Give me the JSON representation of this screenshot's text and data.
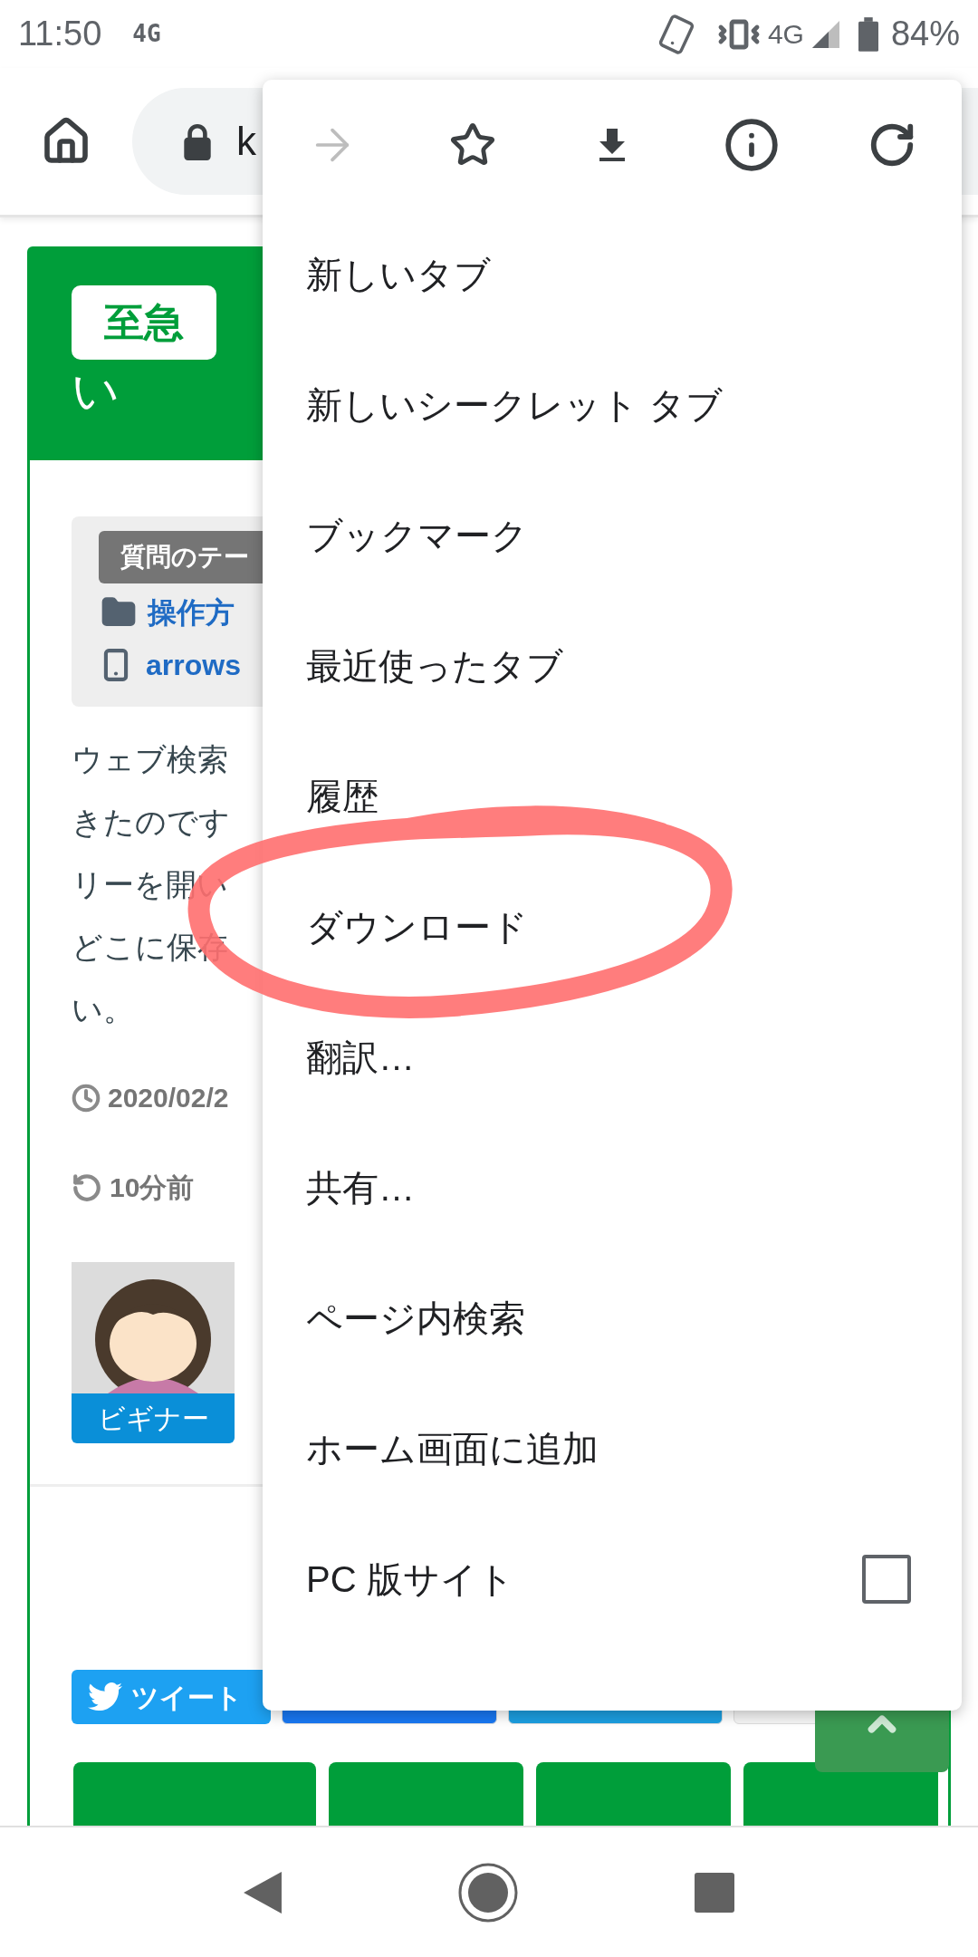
{
  "status_bar": {
    "time": "11:50",
    "network_badge": "4G",
    "network": "4G",
    "battery": "84%"
  },
  "toolbar": {
    "url": "k"
  },
  "page": {
    "badge": "至急",
    "title_lines": [
      "い"
    ],
    "tag_label": "質問のテー",
    "category": "操作方",
    "device": "arrows",
    "body_lines": [
      "ウェブ検索",
      "きたのです",
      "リーを開い",
      "どこに保存",
      "い。"
    ],
    "date": "2020/02/2",
    "updated": "10分前",
    "user_rank": "ビギナー",
    "share_buttons": [
      {
        "label": "ツイート",
        "color": "#1da1f2"
      },
      {
        "color": "#1877f2"
      },
      {
        "color": "#1b9ee0"
      },
      {
        "color": "#f5f5f5"
      }
    ]
  },
  "menu": {
    "icons": [
      {
        "kind": "forward",
        "disabled": true
      },
      {
        "kind": "bookmark",
        "disabled": false
      },
      {
        "kind": "download",
        "disabled": false
      },
      {
        "kind": "info",
        "disabled": false
      },
      {
        "kind": "reload",
        "disabled": false
      }
    ],
    "items": [
      {
        "kind": "plain",
        "label": "新しいタブ"
      },
      {
        "kind": "plain",
        "label": "新しいシークレット タブ"
      },
      {
        "kind": "plain",
        "label": "ブックマーク"
      },
      {
        "kind": "plain",
        "label": "最近使ったタブ"
      },
      {
        "kind": "plain",
        "label": "履歴"
      },
      {
        "kind": "plain",
        "label": "ダウンロード"
      },
      {
        "kind": "plain",
        "label": "翻訳…"
      },
      {
        "kind": "plain",
        "label": "共有…"
      },
      {
        "kind": "plain",
        "label": "ページ内検索"
      },
      {
        "kind": "plain",
        "label": "ホーム画面に追加"
      },
      {
        "kind": "checkbox",
        "label": "PC 版サイト",
        "checked": false
      }
    ]
  }
}
